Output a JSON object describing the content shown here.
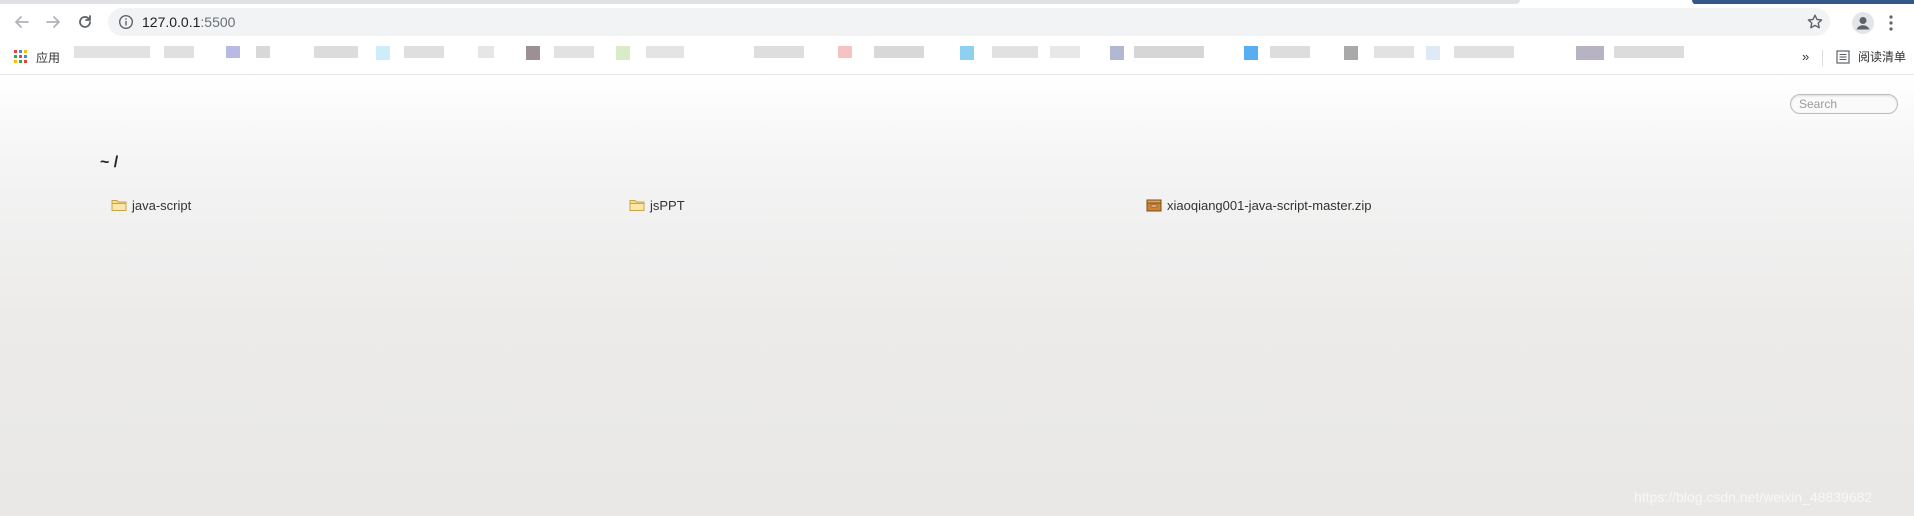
{
  "browser": {
    "address": {
      "host": "127.0.0.1",
      "port": ":5500"
    },
    "icons": {
      "back": "back-arrow-icon",
      "forward": "forward-arrow-icon",
      "reload": "reload-icon",
      "site_info": "info-icon",
      "bookmark_star": "star-icon",
      "profile": "profile-icon",
      "menu": "vertical-dots-icon"
    },
    "bookmarks_bar": {
      "apps_label": "应用",
      "more_label": "»",
      "reading_list_label": "阅读清单"
    }
  },
  "page": {
    "search_placeholder": "Search",
    "breadcrumb": "~ /",
    "entries": [
      {
        "name": "java-script",
        "type": "folder"
      },
      {
        "name": "jsPPT",
        "type": "folder"
      },
      {
        "name": "xiaoqiang001-java-script-master.zip",
        "type": "archive"
      }
    ],
    "watermark": "https://blog.csdn.net/weixin_48839682"
  },
  "colors": {
    "tab_strip_accent": "#35568a",
    "omnibox_bg": "#f1f3f4",
    "folder_yellow": "#f3cf6a",
    "archive_brown": "#b8742d"
  }
}
